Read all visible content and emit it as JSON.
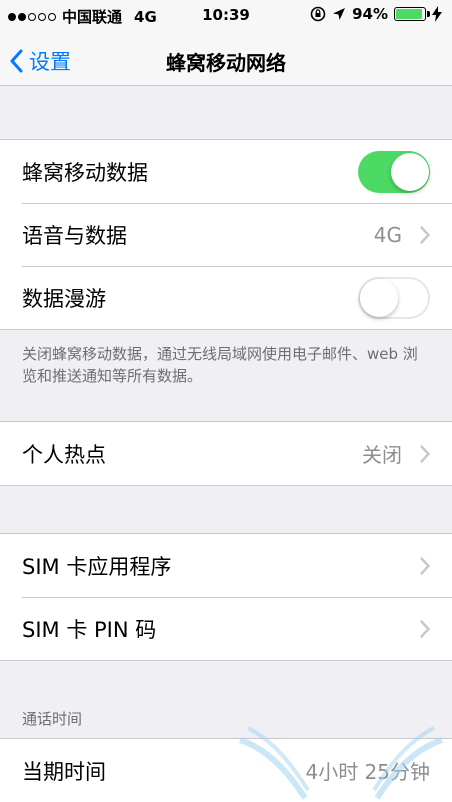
{
  "status": {
    "carrier": "中国联通",
    "network": "4G",
    "time": "10:39",
    "battery": "94%",
    "battery_level": 0.94
  },
  "nav": {
    "back_label": "设置",
    "title": "蜂窝移动网络"
  },
  "cells": {
    "cellular_data": {
      "label": "蜂窝移动数据",
      "on": true
    },
    "voice_data": {
      "label": "语音与数据",
      "value": "4G"
    },
    "roaming": {
      "label": "数据漫游",
      "on": false
    }
  },
  "footer": {
    "note": "关闭蜂窝移动数据，通过无线局域网使用电子邮件、web 浏览和推送通知等所有数据。"
  },
  "hotspot": {
    "label": "个人热点",
    "value": "关闭"
  },
  "sim": {
    "apps_label": "SIM 卡应用程序",
    "pin_label": "SIM 卡 PIN 码"
  },
  "call_time": {
    "header": "通话时间",
    "current_label": "当期时间",
    "current_value": "4小时 25分钟"
  },
  "colors": {
    "accent": "#007aff",
    "toggle_on": "#4cd964",
    "background": "#efeff4"
  }
}
